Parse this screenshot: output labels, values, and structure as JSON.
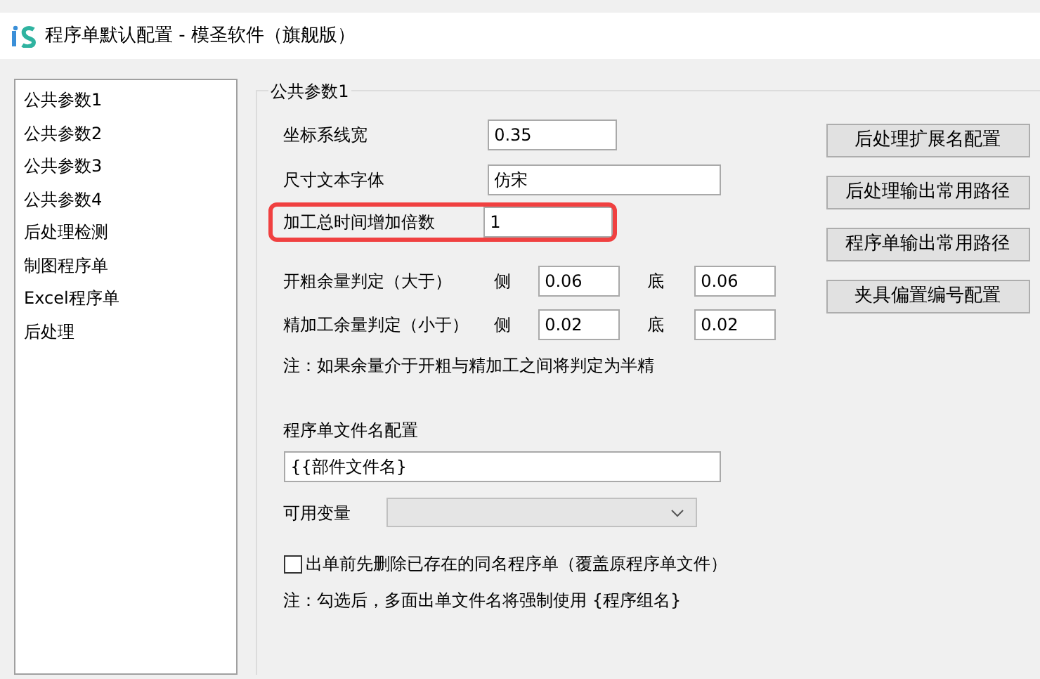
{
  "window": {
    "title": "程序单默认配置 - 模圣软件（旗舰版）"
  },
  "sidebar": {
    "items": [
      {
        "label": "公共参数1",
        "selected": false
      },
      {
        "label": "公共参数2",
        "selected": false
      },
      {
        "label": "公共参数3",
        "selected": false
      },
      {
        "label": "公共参数4",
        "selected": false
      },
      {
        "label": "后处理检测",
        "selected": false
      },
      {
        "label": "制图程序单",
        "selected": false
      },
      {
        "label": "Excel程序单",
        "selected": false
      },
      {
        "label": "后处理",
        "selected": false
      }
    ]
  },
  "group": {
    "title": "公共参数1",
    "fields": [
      {
        "label": "坐标系线宽",
        "value": "0.35",
        "kind": "short",
        "highlighted": false
      },
      {
        "label": "尺寸文本字体",
        "value": "仿宋",
        "kind": "long",
        "highlighted": false
      },
      {
        "label": "加工总时间增加倍数",
        "value": "1",
        "kind": "short",
        "highlighted": true
      }
    ],
    "allowance_rows": [
      {
        "label": "开粗余量判定（大于）",
        "side_label": "侧",
        "side_value": "0.06",
        "bottom_label": "底",
        "bottom_value": "0.06"
      },
      {
        "label": "精加工余量判定（小于）",
        "side_label": "侧",
        "side_value": "0.02",
        "bottom_label": "底",
        "bottom_value": "0.02"
      }
    ],
    "note": "注：如果余量介于开粗与精加工之间将判定为半精",
    "filename_label": "程序单文件名配置",
    "filename_value": "{{部件文件名}",
    "variables_label": "可用变量",
    "checkbox": {
      "label": "出单前先删除已存在的同名程序单（覆盖原程序单文件）",
      "checked": false
    },
    "note2": "注：勾选后，多面出单文件名将强制使用 {程序组名}"
  },
  "buttons": [
    "后处理扩展名配置",
    "后处理输出常用路径",
    "程序单输出常用路径",
    "夹具偏置编号配置"
  ]
}
